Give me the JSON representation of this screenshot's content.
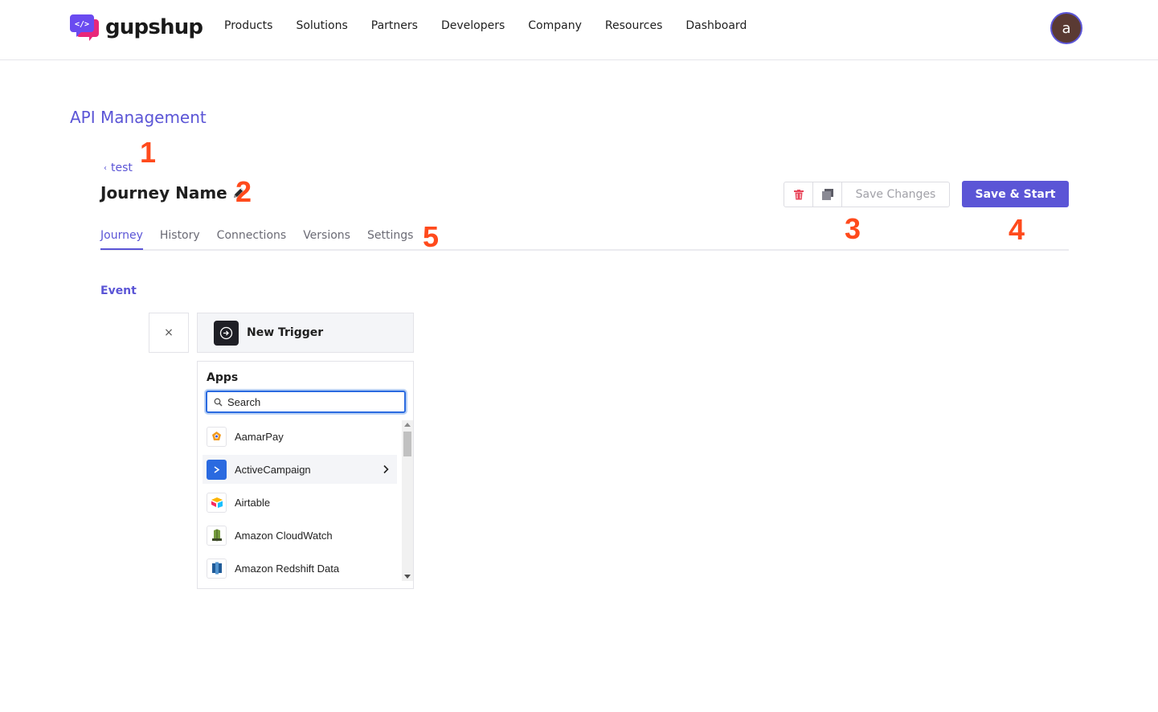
{
  "header": {
    "brand": "gupshup",
    "nav": [
      "Products",
      "Solutions",
      "Partners",
      "Developers",
      "Company",
      "Resources",
      "Dashboard"
    ],
    "avatar_initial": "a"
  },
  "page": {
    "title": "API Management",
    "back_label": "test",
    "journey_name": "Journey Name"
  },
  "annotations": [
    "1",
    "2",
    "3",
    "4",
    "5"
  ],
  "actions": {
    "save_changes": "Save Changes",
    "save_start": "Save & Start"
  },
  "tabs": [
    {
      "label": "Journey",
      "active": true
    },
    {
      "label": "History",
      "active": false
    },
    {
      "label": "Connections",
      "active": false
    },
    {
      "label": "Versions",
      "active": false
    },
    {
      "label": "Settings",
      "active": false
    }
  ],
  "event": {
    "label": "Event",
    "close_symbol": "×",
    "trigger_label": "New Trigger"
  },
  "apps": {
    "title": "Apps",
    "search_placeholder": "Search",
    "items": [
      {
        "label": "AamarPay",
        "icon": "aamarpay-icon"
      },
      {
        "label": "ActiveCampaign",
        "icon": "activecampaign-icon",
        "hovered": true
      },
      {
        "label": "Airtable",
        "icon": "airtable-icon"
      },
      {
        "label": "Amazon CloudWatch",
        "icon": "cloudwatch-icon"
      },
      {
        "label": "Amazon Redshift Data",
        "icon": "redshift-icon"
      }
    ]
  },
  "colors": {
    "accent": "#5b55d6",
    "annotation": "#ff4a1c"
  }
}
